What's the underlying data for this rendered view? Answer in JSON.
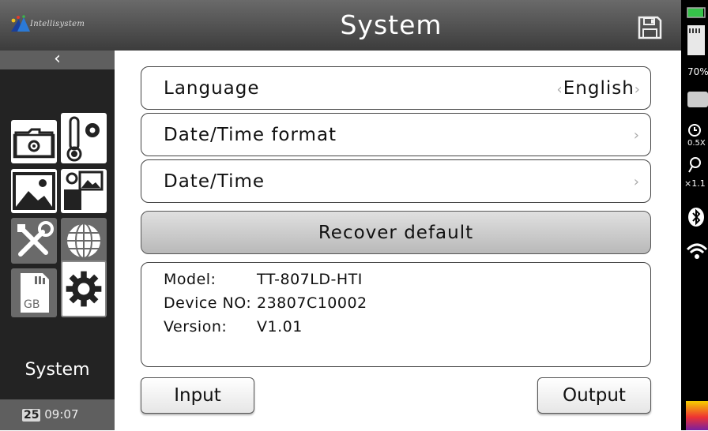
{
  "header": {
    "logo_text": "Intellisystem",
    "title": "System"
  },
  "sidebar": {
    "back_label": "‹",
    "label": "System",
    "date_day": "25",
    "time": "09:07",
    "tiles": [
      "folder-settings",
      "temperature-settings",
      "image",
      "image-mode",
      "tools",
      "globe",
      "storage",
      "system-settings"
    ]
  },
  "settings": {
    "language_label": "Language",
    "language_value": "English",
    "datetime_format_label": "Date/Time format",
    "datetime_label": "Date/Time",
    "recover_label": "Recover default"
  },
  "device_info": {
    "model_key": "Model:",
    "model_value": "TT-807LD-HTI",
    "device_no_key": "Device NO:",
    "device_no_value": "23807C10002",
    "version_key": "Version:",
    "version_value": "V1.01"
  },
  "buttons": {
    "input_label": "Input",
    "output_label": "Output"
  },
  "status": {
    "battery_percent": "70%",
    "zoom_a": "0.5X",
    "zoom_b": "×1.1"
  },
  "colors": {
    "header_top": "#6a6a6a",
    "sidebar_bg": "#232323",
    "battery_green": "#36c24a",
    "palette_warm": "#e33"
  }
}
